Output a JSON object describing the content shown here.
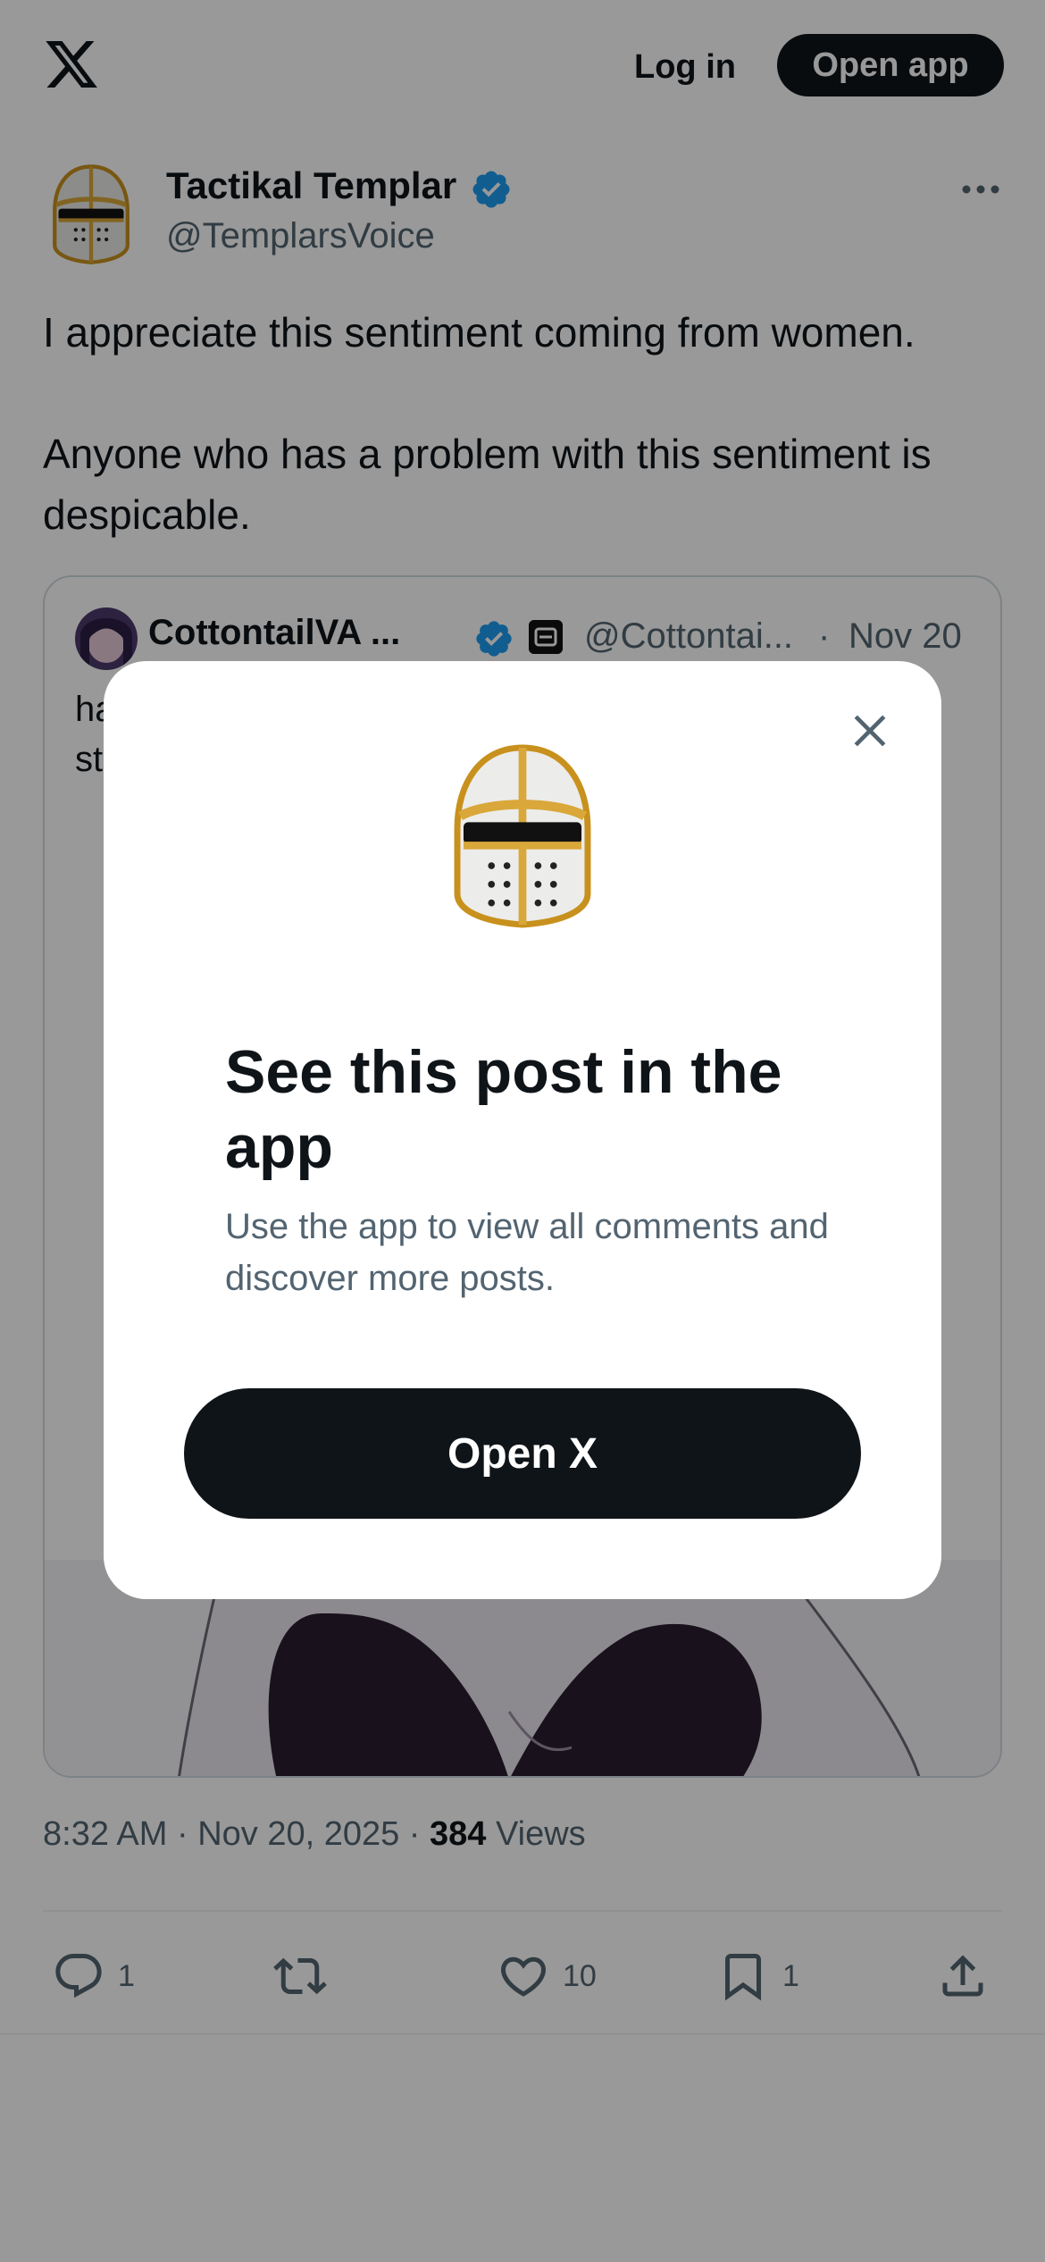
{
  "topbar": {
    "logo_icon": "x-logo-icon",
    "login_label": "Log in",
    "open_app_label": "Open app"
  },
  "post": {
    "author_name": "Tactikal Templar",
    "author_handle": "@TemplarsVoice",
    "text_lines": [
      "I appreciate this sentiment coming from women.",
      "Anyone who has a problem with this sentiment is despicable."
    ],
    "timestamp": "8:32 AM · Nov 20, 2025 · ",
    "views_count": "384",
    "views_label": " Views"
  },
  "quote": {
    "author_name": "CottontailVA ...",
    "author_handle": "@Cottontai...",
    "separator": "·",
    "date": "Nov 20",
    "text_line_1": "ha",
    "text_line_2": "st"
  },
  "actions": {
    "replies": "1",
    "reposts": "",
    "likes": "10",
    "bookmarks": "1"
  },
  "modal": {
    "title": "See this post in the app",
    "subtitle": "Use the app to view all comments and discover more posts.",
    "button_label": "Open X"
  },
  "colors": {
    "text_primary": "#0f1419",
    "text_secondary": "#536471",
    "verified_blue": "#1d9bf0",
    "button_dark": "#0f1419",
    "overlay": "rgba(0,0,0,0.4)"
  }
}
